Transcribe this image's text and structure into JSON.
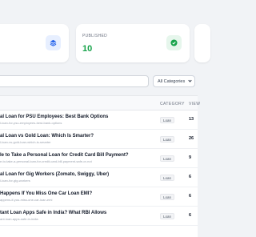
{
  "stats": {
    "published": {
      "label": "PUBLISHED",
      "value": "10",
      "color": "#16a34a"
    }
  },
  "filters": {
    "category_selected": "All Categories"
  },
  "table": {
    "columns": {
      "category": "CATEGORY",
      "views": "VIEW"
    },
    "rows": [
      {
        "title": "al Loan for PSU Employees: Best Bank Options",
        "slug": "l-loan-for-psu-employees-best-bank-options",
        "category": "Loan",
        "views": "13"
      },
      {
        "title": "al Loan vs Gold Loan: Which Is Smarter?",
        "slug": "l-loan-vs-gold-loan-which-is-smarter",
        "category": "Loan",
        "views": "26"
      },
      {
        "title": "le to Take a Personal Loan for Credit Card Bill Payment?",
        "slug": "e-to-take-a-personal-loan-for-credit-card-bill-payment-safe-or-not",
        "category": "Loan",
        "views": "9"
      },
      {
        "title": "al Loan for Gig Workers (Zomato, Swiggy, Uber)",
        "slug": "l-loan-for-gig-workers",
        "category": "Loan",
        "views": "6"
      },
      {
        "title": "Happens If You Miss One Car Loan EMI?",
        "slug": "appens-if-you-miss-one-car-loan-emi",
        "category": "Loan",
        "views": "6"
      },
      {
        "title": "tant Loan Apps Safe in India? What RBI Allows",
        "slug": "ant-loan-apps-safe-in-india",
        "category": "Loan",
        "views": "6"
      }
    ]
  }
}
